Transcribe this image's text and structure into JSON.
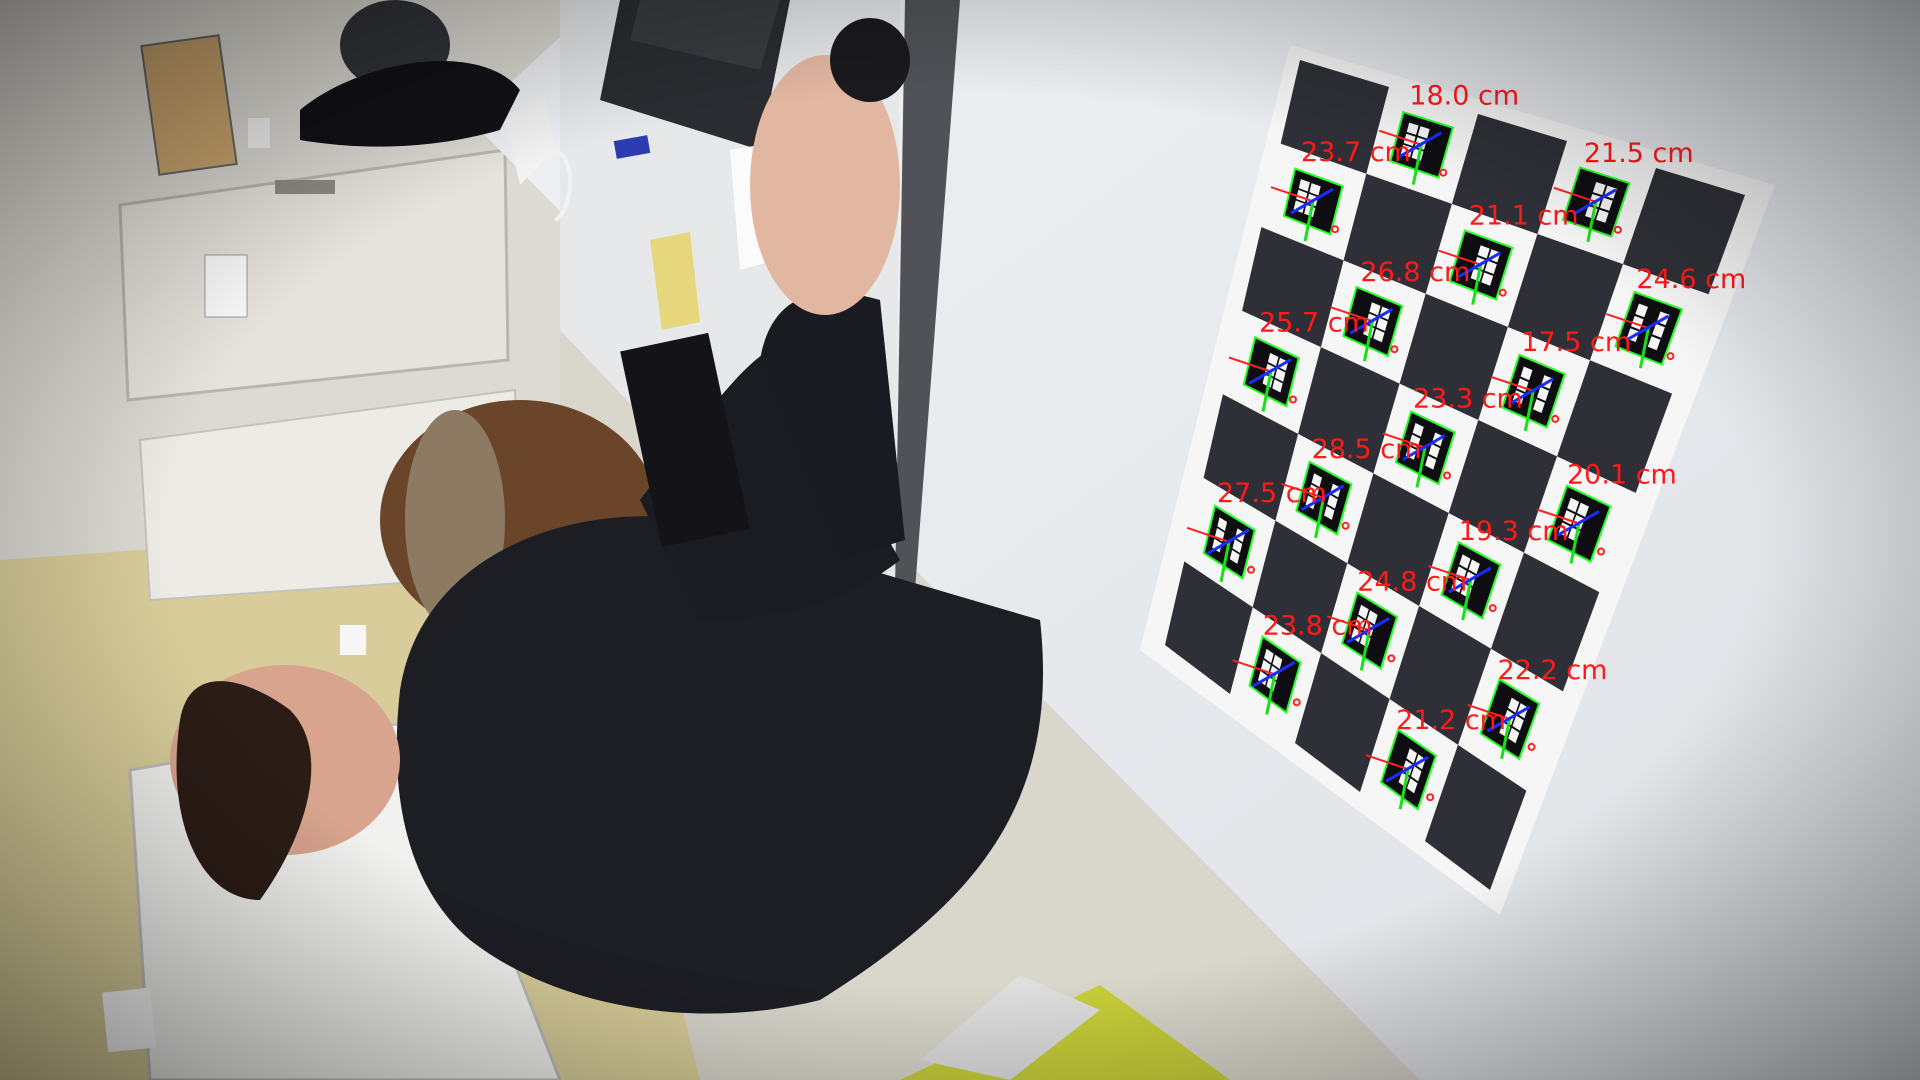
{
  "scene": {
    "description_free": true,
    "board": {
      "rows": 7,
      "cols": 5,
      "colors": {
        "square": "#2f2f37",
        "paper": "#f6f6f6",
        "marker_outline": "#22ff22"
      }
    },
    "axis_colors": {
      "x": "#ff2020",
      "y": "#18e018",
      "z": "#1a2cff"
    },
    "label_color": "#ff1a1a",
    "markers": [
      {
        "id": "m01",
        "label": "21.5 cm"
      },
      {
        "id": "m02",
        "label": "18.0 cm"
      },
      {
        "id": "m03",
        "label": "24.6 cm"
      },
      {
        "id": "m04",
        "label": "21.1 cm"
      },
      {
        "id": "m05",
        "label": "23.7 cm"
      },
      {
        "id": "m06",
        "label": "17.5 cm"
      },
      {
        "id": "m07",
        "label": "26.8 cm"
      },
      {
        "id": "m08",
        "label": "20.1 cm"
      },
      {
        "id": "m09",
        "label": "23.3 cm"
      },
      {
        "id": "m10",
        "label": "25.7 cm"
      },
      {
        "id": "m11",
        "label": "19.3 cm"
      },
      {
        "id": "m12",
        "label": "28.5 cm"
      },
      {
        "id": "m13",
        "label": "22.2 cm"
      },
      {
        "id": "m14",
        "label": "24.8 cm"
      },
      {
        "id": "m15",
        "label": "27.5 cm"
      },
      {
        "id": "m16",
        "label": "21.2 cm"
      },
      {
        "id": "m17",
        "label": "23.8 cm"
      }
    ]
  }
}
